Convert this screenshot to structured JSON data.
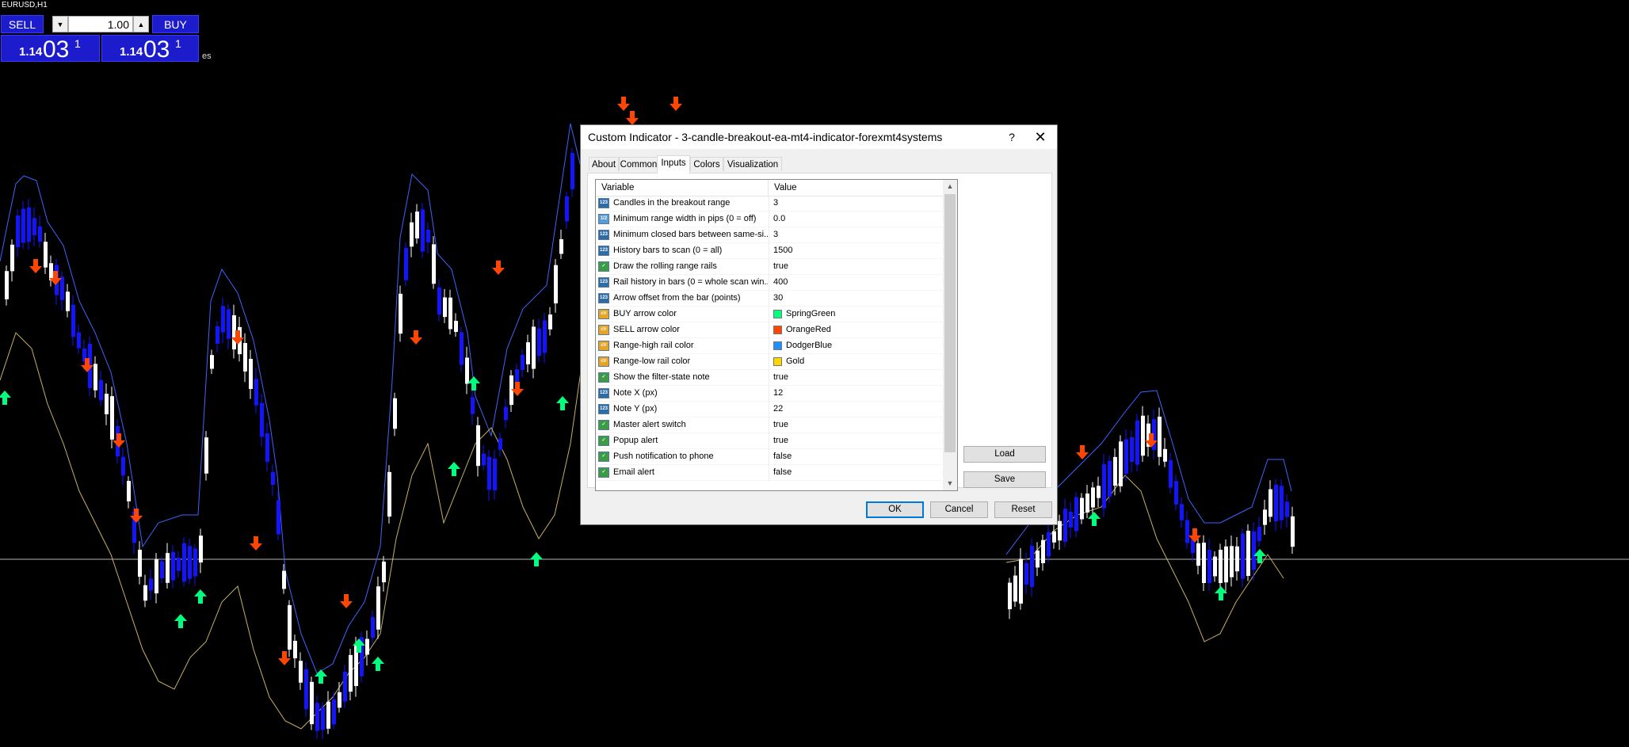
{
  "chart": {
    "symbol": "EURUSD,H1",
    "sell_label": "SELL",
    "buy_label": "BUY",
    "lot_size": "1.00",
    "sell_price": {
      "small": "1.14",
      "big": "03",
      "sup": "1"
    },
    "buy_price": {
      "small": "1.14",
      "big": "03",
      "sup": "1"
    },
    "edge_text": "es",
    "colors": {
      "bull_candle": "#ffffff",
      "bear_candle": "#1414ff",
      "high_rail": "#3c64ff",
      "low_rail": "#c8b060",
      "buy_arrow": "#00ff7f",
      "sell_arrow": "#ff4500",
      "hline": "#b4b4b4"
    }
  },
  "dialog": {
    "title": "Custom Indicator - 3-candle-breakout-ea-mt4-indicator-forexmt4systems",
    "help_glyph": "?",
    "close_glyph": "✕",
    "tabs": [
      "About",
      "Common",
      "Inputs",
      "Colors",
      "Visualization"
    ],
    "active_tab": "Inputs",
    "columns": {
      "variable": "Variable",
      "value": "Value"
    },
    "rows": [
      {
        "type": "int",
        "icon": "123",
        "name": "Candles in the breakout range",
        "value": "3"
      },
      {
        "type": "dbl",
        "icon": "1/2",
        "name": "Minimum range width in pips (0 = off)",
        "value": "0.0"
      },
      {
        "type": "int",
        "icon": "123",
        "name": "Minimum closed bars between same-si...",
        "value": "3"
      },
      {
        "type": "int",
        "icon": "123",
        "name": "History bars to scan (0 = all)",
        "value": "1500"
      },
      {
        "type": "bool",
        "icon": "✓",
        "name": "Draw the rolling range rails",
        "value": "true"
      },
      {
        "type": "int",
        "icon": "123",
        "name": "Rail history in bars (0 = whole scan win...",
        "value": "400"
      },
      {
        "type": "int",
        "icon": "123",
        "name": "Arrow offset from the bar (points)",
        "value": "30"
      },
      {
        "type": "col",
        "icon": "clr",
        "name": "BUY arrow color",
        "value": "SpringGreen",
        "swatch": "#00ff7f"
      },
      {
        "type": "col",
        "icon": "clr",
        "name": "SELL arrow color",
        "value": "OrangeRed",
        "swatch": "#ff4500"
      },
      {
        "type": "col",
        "icon": "clr",
        "name": "Range-high rail color",
        "value": "DodgerBlue",
        "swatch": "#1e90ff"
      },
      {
        "type": "col",
        "icon": "clr",
        "name": "Range-low rail color",
        "value": "Gold",
        "swatch": "#ffd700"
      },
      {
        "type": "bool",
        "icon": "✓",
        "name": "Show the filter-state note",
        "value": "true"
      },
      {
        "type": "int",
        "icon": "123",
        "name": "Note X (px)",
        "value": "12"
      },
      {
        "type": "int",
        "icon": "123",
        "name": "Note Y (px)",
        "value": "22"
      },
      {
        "type": "bool",
        "icon": "✓",
        "name": "Master alert switch",
        "value": "true"
      },
      {
        "type": "bool",
        "icon": "✓",
        "name": "Popup alert",
        "value": "true"
      },
      {
        "type": "bool",
        "icon": "✓",
        "name": "Push notification to phone",
        "value": "false"
      },
      {
        "type": "bool",
        "icon": "✓",
        "name": "Email alert",
        "value": "false"
      }
    ],
    "side_buttons": {
      "load": "Load",
      "save": "Save"
    },
    "buttons": {
      "ok": "OK",
      "cancel": "Cancel",
      "reset": "Reset"
    }
  }
}
